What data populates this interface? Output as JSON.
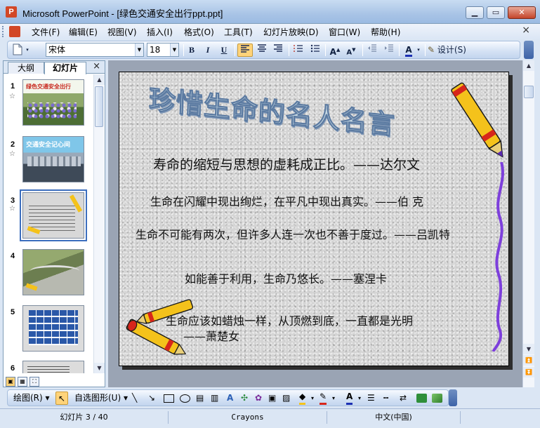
{
  "window": {
    "title": "Microsoft PowerPoint - [绿色交通安全出行ppt.ppt]",
    "app_icon_letter": "P"
  },
  "menu": {
    "items": [
      "文件(F)",
      "编辑(E)",
      "视图(V)",
      "插入(I)",
      "格式(O)",
      "工具(T)",
      "幻灯片放映(D)",
      "窗口(W)",
      "帮助(H)"
    ],
    "close": "×"
  },
  "toolbar": {
    "font_name": "宋体",
    "font_size": "18",
    "bold": "B",
    "italic": "I",
    "underline": "U",
    "design_label": "设计(S)"
  },
  "left_pane": {
    "tabs": [
      "大纲",
      "幻灯片"
    ],
    "active_tab": "幻灯片",
    "close": "×",
    "thumbnails": [
      {
        "num": "1",
        "star": true,
        "title": "绿色交通安全出行"
      },
      {
        "num": "2",
        "star": true,
        "title": "交通安全记心间"
      },
      {
        "num": "3",
        "star": true,
        "selected": true
      },
      {
        "num": "4",
        "star": false
      },
      {
        "num": "5",
        "star": false
      },
      {
        "num": "6",
        "star": false
      }
    ]
  },
  "slide": {
    "title": "珍惜生命的名人名言",
    "quotes": [
      "寿命的缩短与思想的虚耗成正比。——达尔文",
      "生命在闪耀中现出绚烂，在平凡中现出真实。——伯 克",
      "生命不可能有两次，但许多人连一次也不善于度过。——吕凯特",
      "如能善于利用，生命乃悠长。——塞涅卡",
      "生命应该如蜡烛一样，从顶燃到底，一直都是光明",
      "——萧楚女"
    ]
  },
  "drawing_toolbar": {
    "draw_label": "绘图(R)",
    "autoshapes_label": "自选图形(U)"
  },
  "status": {
    "slide_info": "幻灯片 3 / 40",
    "design": "Crayons",
    "language": "中文(中国)"
  },
  "colors": {
    "accent": "#3c6ebe",
    "title_fill": "#c5d7e2",
    "title_outline": "#5b7aa1",
    "ribbon": "#7d3fdc",
    "crayon_yellow": "#f4c21b",
    "crayon_red": "#d7261b"
  }
}
